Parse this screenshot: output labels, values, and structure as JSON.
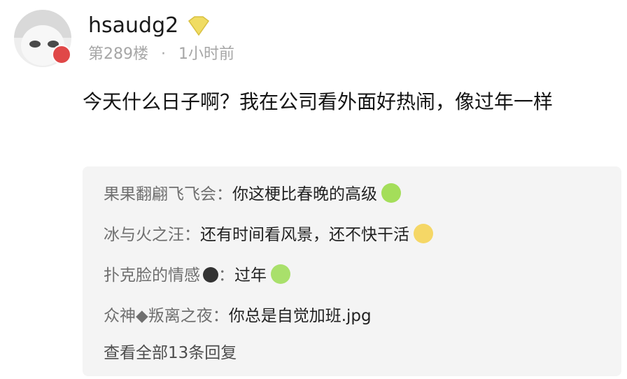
{
  "post": {
    "username": "hsaudg2",
    "floor": "第289楼",
    "time": "1小时前",
    "content": "今天什么日子啊？我在公司看外面好热闹，像过年一样"
  },
  "replies": [
    {
      "name": "果果翻翩飞飞会：",
      "text": "你这梗比春晚的高级",
      "emoji": "grinning-face-icon"
    },
    {
      "name": "冰与火之汪：",
      "text": "还有时间看风景，还不快干活",
      "emoji": "smiling-face-icon"
    },
    {
      "name": "扑克脸的情感",
      "name_suffix": "：",
      "text": "过年",
      "emoji": "grinning-face-icon"
    },
    {
      "name": "众神◆叛离之夜：",
      "text": "你总是自觉加班.jpg"
    }
  ],
  "view_all": "查看全部13条回复",
  "colors": {
    "accent": "#7a7a7a",
    "emoji_green": "#a4de5a",
    "emoji_yellow": "#f5d766"
  }
}
